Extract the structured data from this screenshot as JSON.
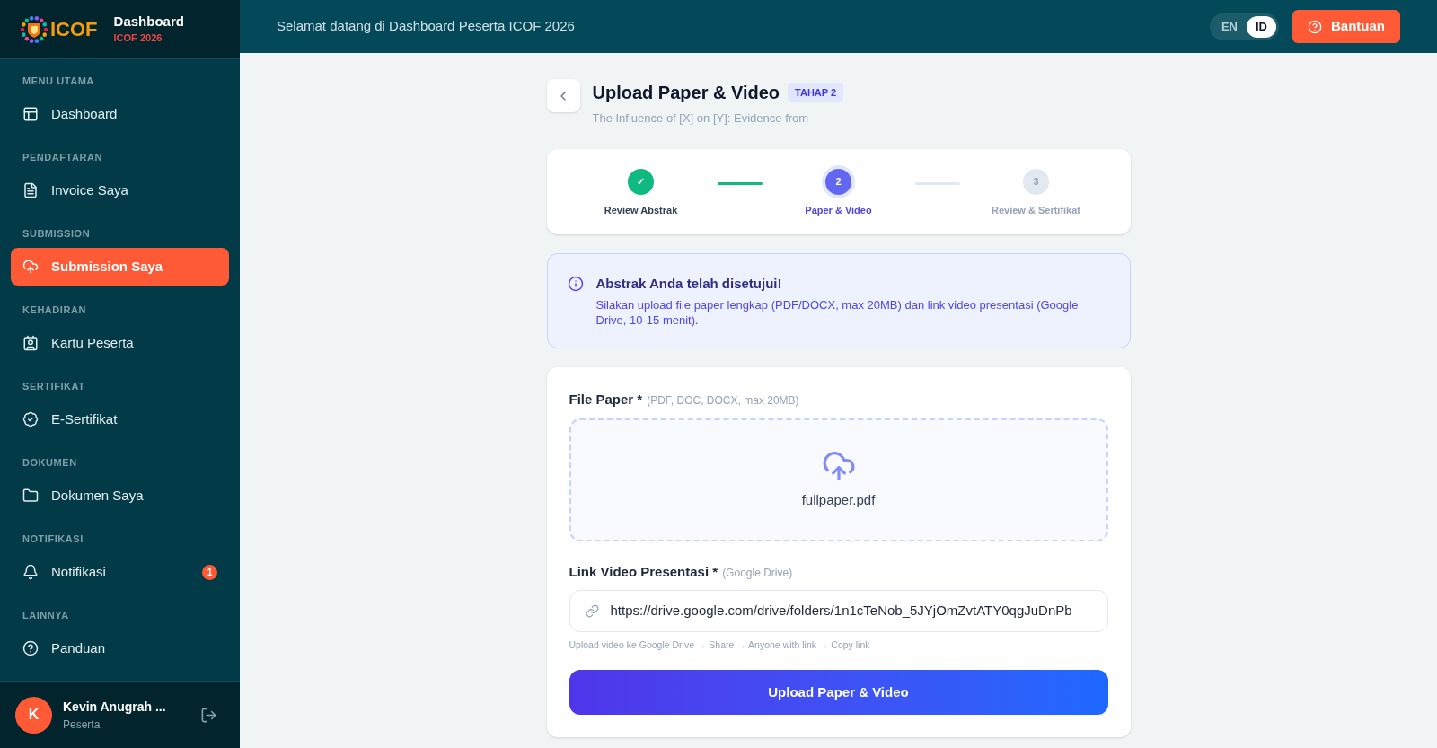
{
  "brand": {
    "logo_text": "ICOF",
    "title": "Dashboard",
    "subtitle": "ICOF 2026"
  },
  "sidebar": {
    "sections": [
      {
        "label": "MENU UTAMA",
        "items": [
          {
            "label": "Dashboard",
            "selected": false
          }
        ]
      },
      {
        "label": "PENDAFTARAN",
        "items": [
          {
            "label": "Invoice Saya",
            "selected": false
          }
        ]
      },
      {
        "label": "SUBMISSION",
        "items": [
          {
            "label": "Submission Saya",
            "selected": true
          }
        ]
      },
      {
        "label": "KEHADIRAN",
        "items": [
          {
            "label": "Kartu Peserta",
            "selected": false
          }
        ]
      },
      {
        "label": "SERTIFIKAT",
        "items": [
          {
            "label": "E-Sertifikat",
            "selected": false
          }
        ]
      },
      {
        "label": "DOKUMEN",
        "items": [
          {
            "label": "Dokumen Saya",
            "selected": false
          }
        ]
      },
      {
        "label": "NOTIFIKASI",
        "items": [
          {
            "label": "Notifikasi",
            "selected": false,
            "badge": "1"
          }
        ]
      },
      {
        "label": "LAINNYA",
        "items": [
          {
            "label": "Panduan",
            "selected": false
          }
        ]
      }
    ],
    "user": {
      "initial": "K",
      "name": "Kevin Anugrah ...",
      "role": "Peserta"
    }
  },
  "header": {
    "welcome": "Selamat datang di Dashboard Peserta ICOF 2026",
    "languages": [
      {
        "label": "EN",
        "selected": false
      },
      {
        "label": "ID",
        "selected": true
      }
    ],
    "help_button": "Bantuan"
  },
  "page": {
    "title": "Upload Paper & Video",
    "badge": "TAHAP 2",
    "subtitle": "The Influence of [X] on [Y]: Evidence from"
  },
  "steps": [
    {
      "marker": "✓",
      "label": "Review Abstrak",
      "done": true,
      "selected": false
    },
    {
      "marker": "2",
      "label": "Paper & Video",
      "done": false,
      "selected": true
    },
    {
      "marker": "3",
      "label": "Review & Sertifikat",
      "done": false,
      "selected": false
    }
  ],
  "alert": {
    "title": "Abstrak Anda telah disetujui!",
    "message": "Silakan upload file paper lengkap (PDF/DOCX, max 20MB) dan link video presentasi (Google Drive, 10-15 menit)."
  },
  "form": {
    "file_label": "File Paper *",
    "file_hint": "(PDF, DOC, DOCX, max 20MB)",
    "file_name": "fullpaper.pdf",
    "link_label": "Link Video Presentasi *",
    "link_hint": "(Google Drive)",
    "link_value": "https://drive.google.com/drive/folders/1n1cTeNob_5JYjOmZvtATY0qgJuDnPb",
    "link_help": "Upload video ke Google Drive → Share → Anyone with link → Copy link",
    "submit": "Upload Paper & Video"
  }
}
